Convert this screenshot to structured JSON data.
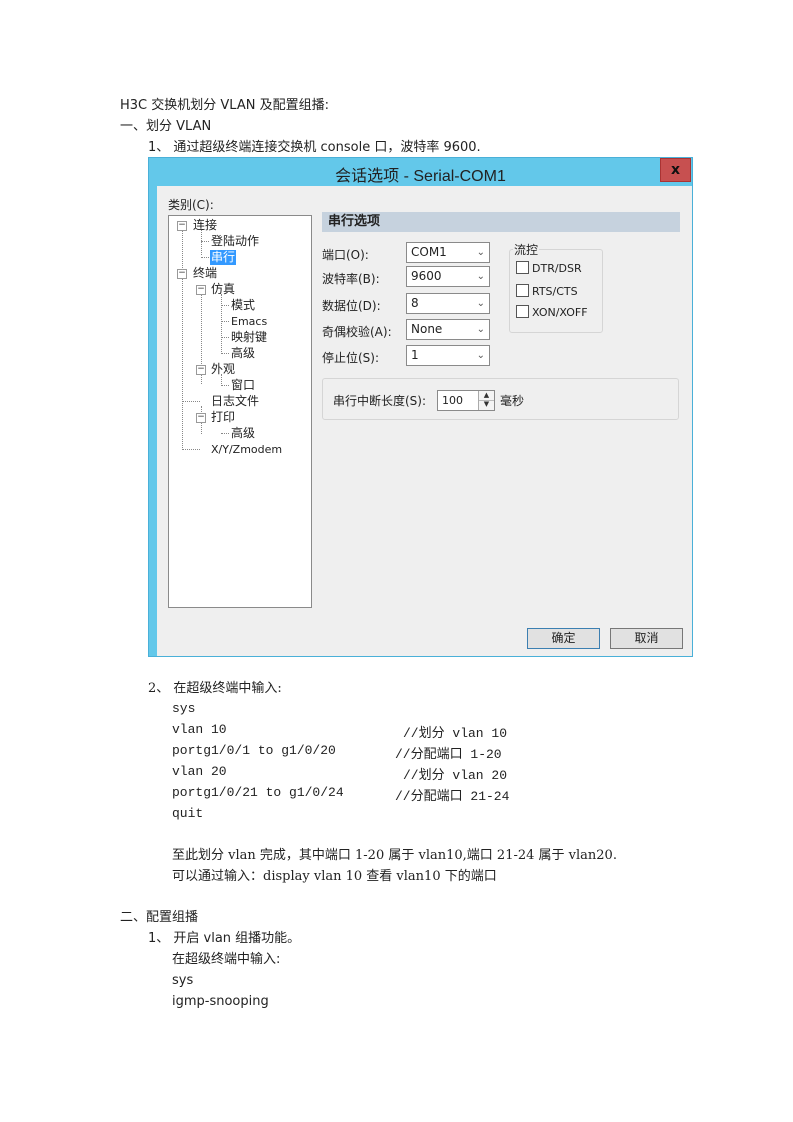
{
  "document": {
    "title": "H3C 交换机划分 VLAN 及配置组播:",
    "section1": {
      "heading": "一、划分 VLAN",
      "step1": "1、 通过超级终端连接交换机 console 口，波特率 9600.",
      "step2": "2、 在超级终端中输入:",
      "commands": [
        {
          "cmd": "sys",
          "comment": ""
        },
        {
          "cmd": "vlan 10",
          "comment": "//划分 vlan 10"
        },
        {
          "cmd": "portg1/0/1 to g1/0/20",
          "comment": "//分配端口 1-20"
        },
        {
          "cmd": "vlan 20",
          "comment": "//划分 vlan 20"
        },
        {
          "cmd": "portg1/0/21 to g1/0/24",
          "comment": "//分配端口 21-24"
        },
        {
          "cmd": "quit",
          "comment": ""
        }
      ],
      "note1": "至此划分 vlan 完成，其中端口 1-20 属于 vlan10,端口 21-24 属于 vlan20.",
      "note2": "可以通过输入：display vlan 10 查看 vlan10 下的端口"
    },
    "section2": {
      "heading": "二、配置组播",
      "step1": "1、 开启 vlan 组播功能。",
      "step1_sub": "在超级终端中输入:",
      "commands": [
        "sys",
        "igmp-snooping"
      ]
    }
  },
  "dialog": {
    "title": "会话选项 - Serial-COM1",
    "close_label": "x",
    "category_label": "类别(C):",
    "tree": [
      {
        "label": "连接",
        "toggle": "−"
      },
      {
        "label": "登陆动作"
      },
      {
        "label": "串行",
        "selected": true
      },
      {
        "label": "终端",
        "toggle": "−"
      },
      {
        "label": "仿真",
        "toggle": "−"
      },
      {
        "label": "模式"
      },
      {
        "label": "Emacs"
      },
      {
        "label": "映射键"
      },
      {
        "label": "高级"
      },
      {
        "label": "外观",
        "toggle": "−"
      },
      {
        "label": "窗口"
      },
      {
        "label": "日志文件"
      },
      {
        "label": "打印",
        "toggle": "−"
      },
      {
        "label": "高级"
      },
      {
        "label": "X/Y/Zmodem"
      }
    ],
    "section_title": "串行选项",
    "fields": [
      {
        "label": "端口(O):",
        "value": "COM1"
      },
      {
        "label": "波特率(B):",
        "value": "9600"
      },
      {
        "label": "数据位(D):",
        "value": "8"
      },
      {
        "label": "奇偶校验(A):",
        "value": "None"
      },
      {
        "label": "停止位(S):",
        "value": "1"
      }
    ],
    "flow_control": {
      "title": "流控",
      "options": [
        {
          "label": "DTR/DSR",
          "checked": false
        },
        {
          "label": "RTS/CTS",
          "checked": false
        },
        {
          "label": "XON/XOFF",
          "checked": false
        }
      ]
    },
    "break_length": {
      "label": "串行中断长度(S):",
      "value": "100",
      "unit": "毫秒"
    },
    "ok_label": "确定",
    "cancel_label": "取消"
  }
}
